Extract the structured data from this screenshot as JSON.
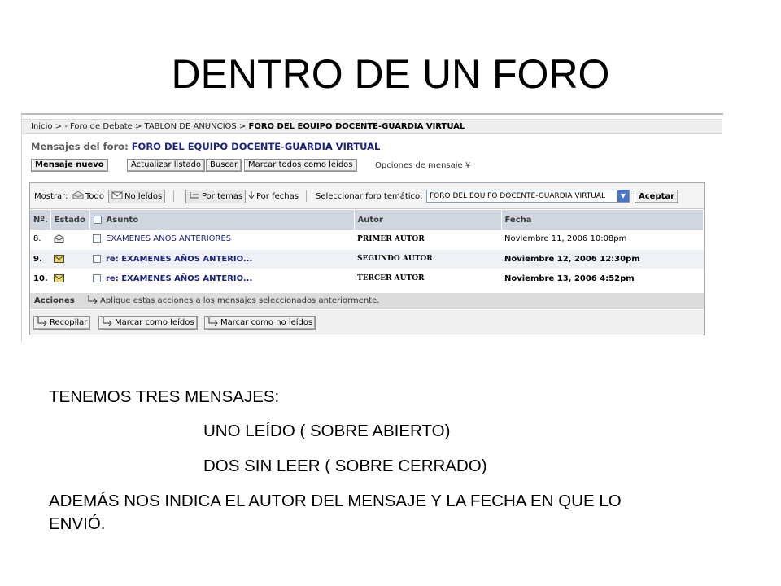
{
  "slide": {
    "title": "DENTRO DE UN FORO"
  },
  "breadcrumb": {
    "path": "Inicio > - Foro de Debate > TABLON DE ANUNCIOS > ",
    "current": "FORO DEL EQUIPO DOCENTE-GUARDIA VIRTUAL"
  },
  "forum": {
    "heading_label": "Mensajes del foro: ",
    "heading_name": "FORO DEL EQUIPO DOCENTE-GUARDIA VIRTUAL"
  },
  "toolbar": {
    "new_message": "Mensaje nuevo",
    "refresh": "Actualizar listado",
    "search": "Buscar",
    "mark_all_read": "Marcar todos como leídos",
    "message_options": "Opciones de mensaje ¥"
  },
  "filters": {
    "show_label": "Mostrar:",
    "all": "Todo",
    "unread": "No leídos",
    "by_topic": "Por temas",
    "by_date": "Por fechas",
    "select_forum_label": "Seleccionar foro temático:",
    "selected_forum": "FORO DEL EQUIPO DOCENTE-GUARDIA VIRTUAL",
    "accept": "Aceptar"
  },
  "table": {
    "columns": [
      "Nº.",
      "Estado",
      "Asunto",
      "Autor",
      "Fecha"
    ],
    "rows": [
      {
        "num": "8.",
        "status": "read",
        "subject": "EXAMENES AÑOS ANTERIORES",
        "author": "PRIMER AUTOR",
        "date": "Noviembre 11, 2006 10:08pm"
      },
      {
        "num": "9.",
        "status": "unread",
        "subject": "re: EXAMENES AÑOS ANTERIO...",
        "author": "SEGUNDO AUTOR",
        "date": "Noviembre 12, 2006 12:30pm"
      },
      {
        "num": "10.",
        "status": "unread",
        "subject": "re: EXAMENES AÑOS ANTERIO...",
        "author": "TERCER AUTOR",
        "date": "Noviembre 13, 2006 4:52pm"
      }
    ]
  },
  "actions": {
    "label": "Acciones",
    "hint": "Aplique estas acciones a los mensajes seleccionados anteriormente.",
    "collect": "Recopilar",
    "mark_read": "Marcar como leídos",
    "mark_unread": "Marcar como no leídos"
  },
  "notes": {
    "intro": "TENEMOS TRES MENSAJES:",
    "line1": "UNO LEÍDO ( SOBRE ABIERTO)",
    "line2": "DOS SIN LEER ( SOBRE CERRADO)",
    "line3a": "ADEMÁS NOS INDICA EL AUTOR DEL MENSAJE Y LA FECHA EN QUE LO",
    "line3b": "ENVIÓ."
  },
  "colors": {
    "link": "#1a237e",
    "header_row": "#cfd6e0",
    "envelope_unread": "#e8d76a"
  }
}
